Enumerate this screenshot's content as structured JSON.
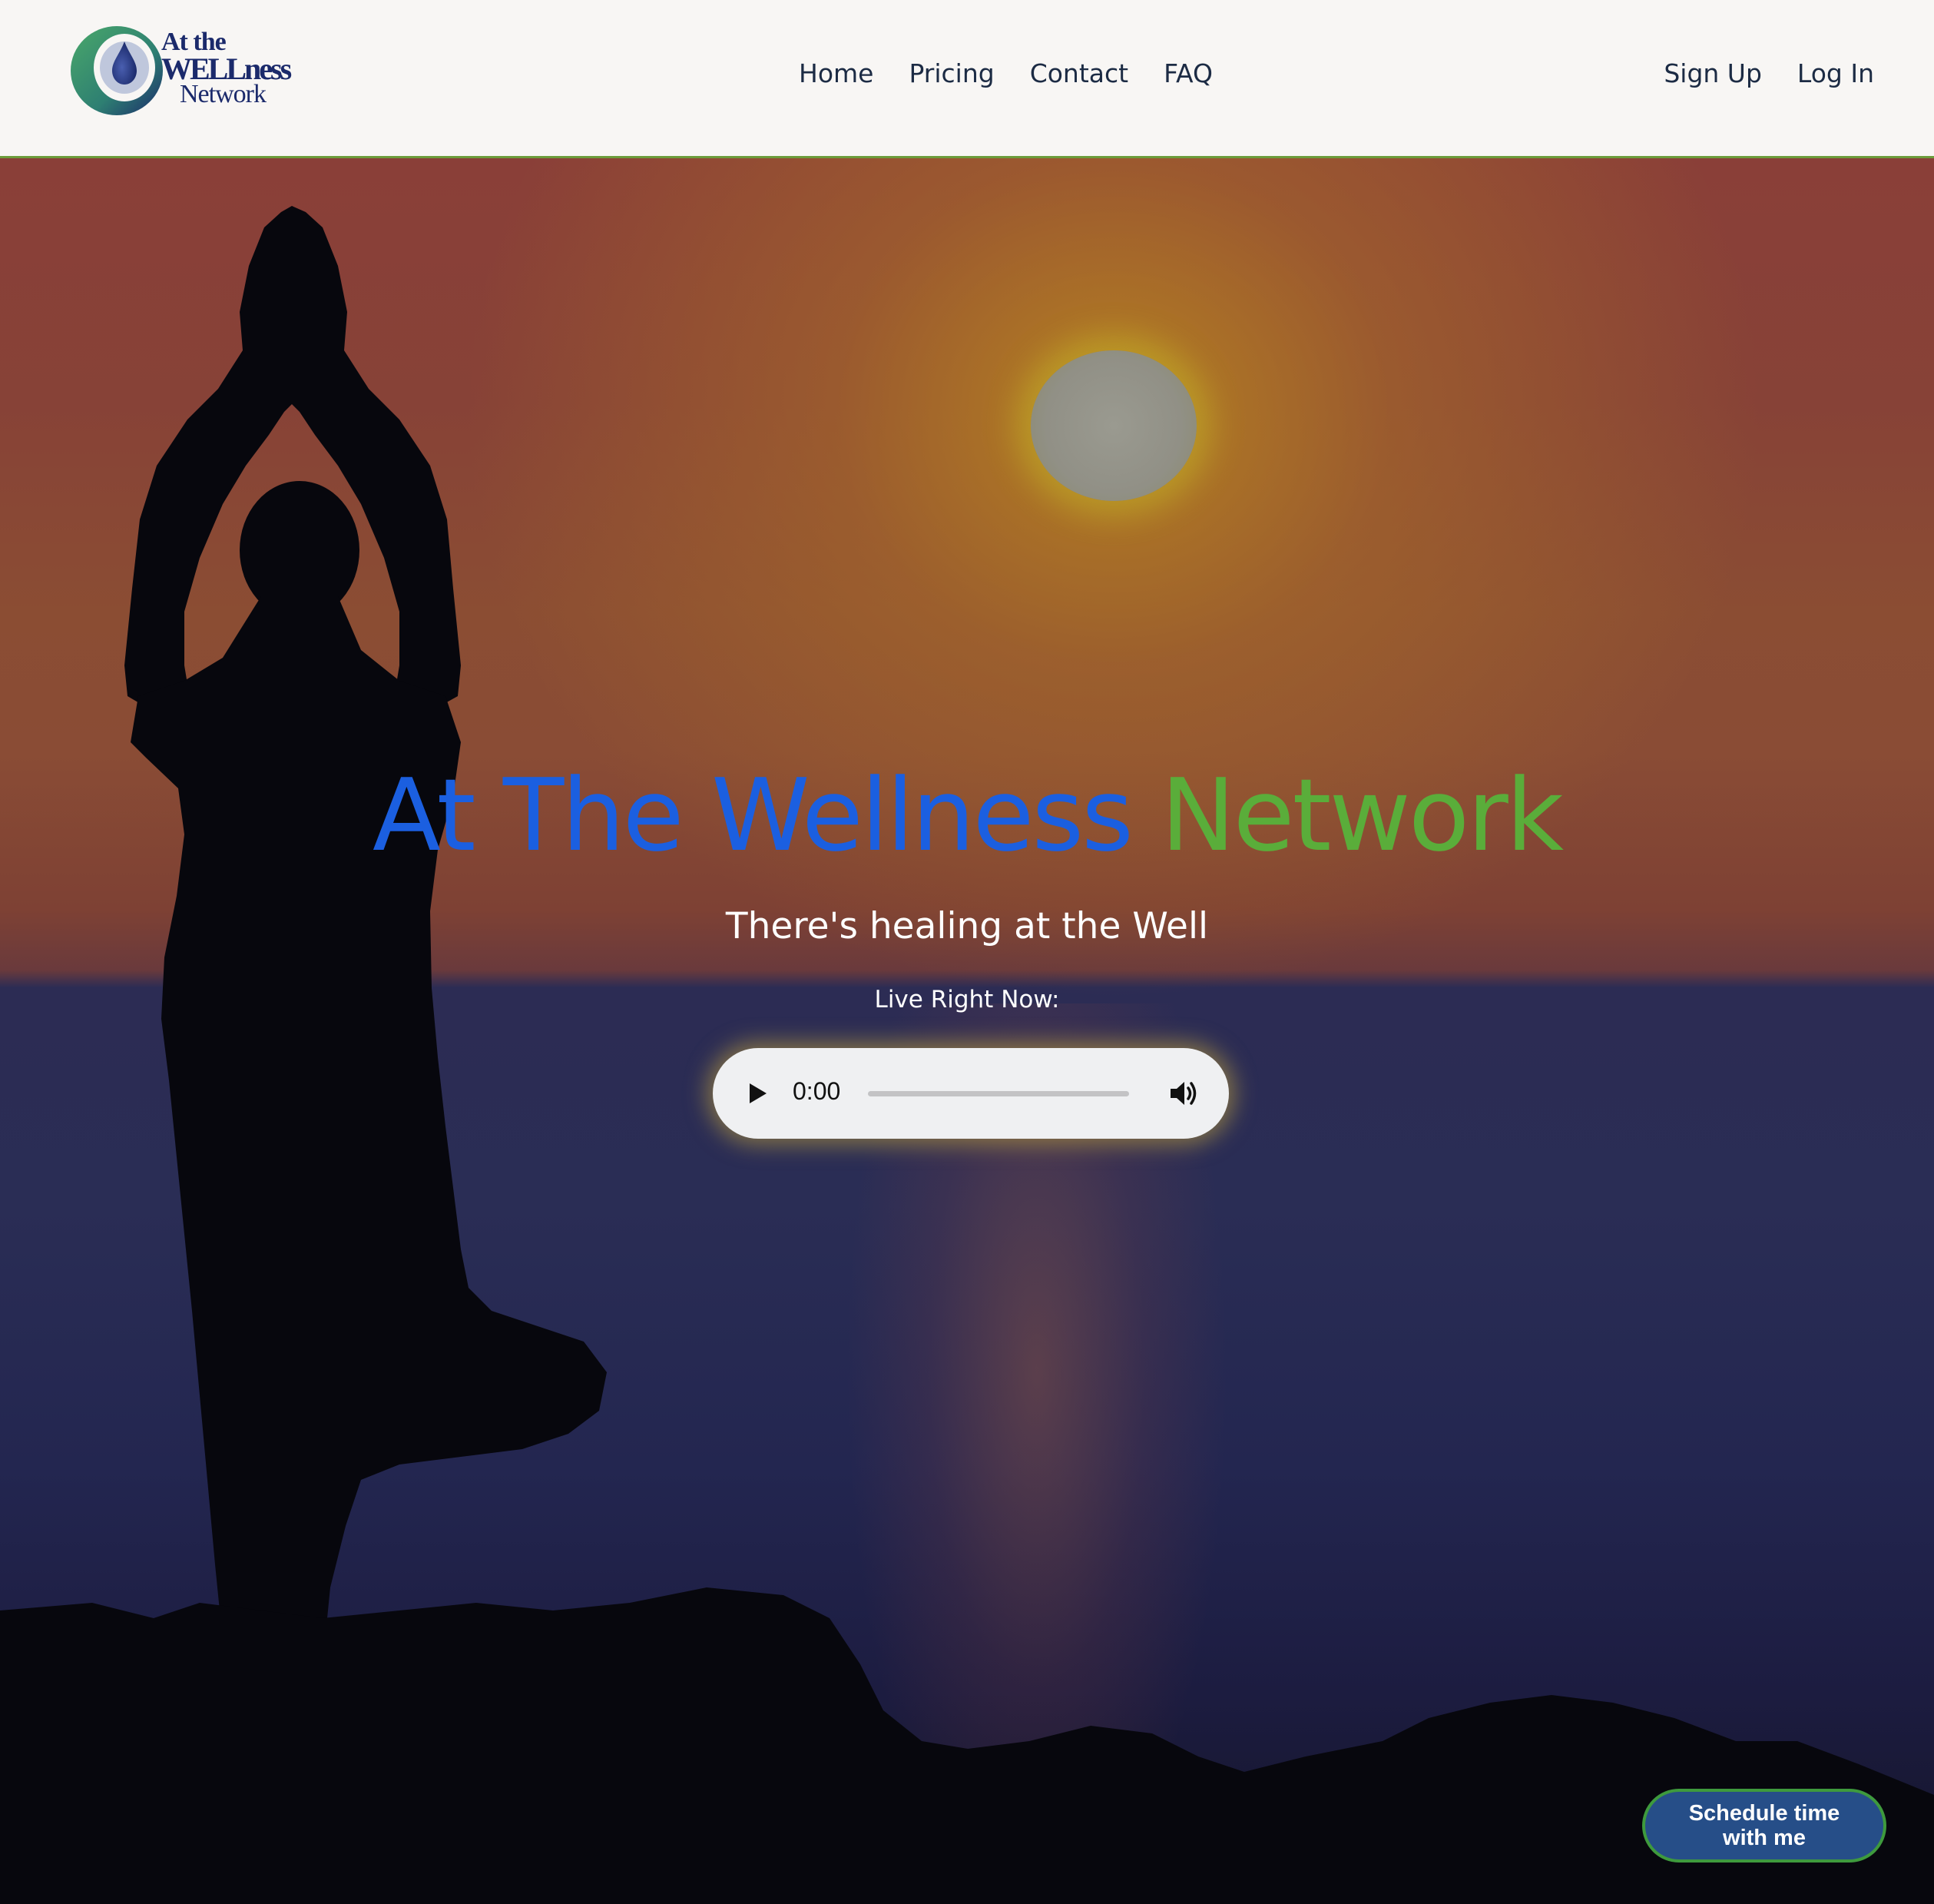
{
  "header": {
    "logo": {
      "line1": "At the",
      "line2": "WELLness",
      "line3": "Network"
    },
    "nav": [
      {
        "label": "Home"
      },
      {
        "label": "Pricing"
      },
      {
        "label": "Contact"
      },
      {
        "label": "FAQ"
      }
    ],
    "auth": {
      "sign_up": "Sign Up",
      "log_in": "Log In"
    }
  },
  "hero": {
    "title_part1": "At The Wellness",
    "title_part2": "Network",
    "tagline": "There's healing at the Well",
    "live_label": "Live Right Now:",
    "audio": {
      "current_time": "0:00",
      "progress_fraction": 0,
      "play_icon": "play-icon",
      "volume_icon": "volume-icon"
    }
  },
  "schedule_button": {
    "line1": "Schedule time",
    "line2": "with me"
  },
  "colors": {
    "title_blue": "#1b5fe0",
    "title_green": "#5aad3a",
    "header_bg": "#f8f6f4",
    "header_border": "#6c9c3a",
    "schedule_bg": "#264e88",
    "schedule_border": "#3e9a3d"
  }
}
